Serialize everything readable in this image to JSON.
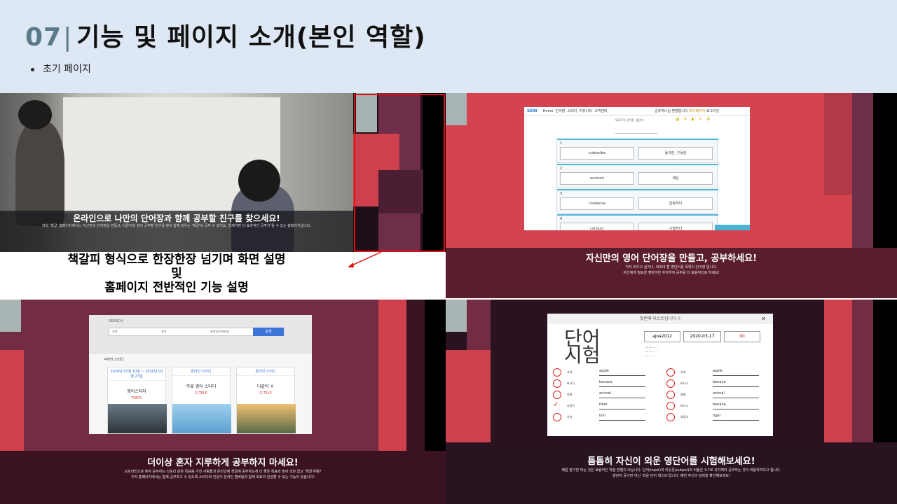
{
  "header": {
    "number": "07",
    "separator": "|",
    "title": "기능 및 페이지 소개(본인 역할)",
    "bullet": "초기 페이지"
  },
  "slide1": {
    "caption_title": "온라인으로 나만의 단어장과 함께 공부할 친구를 찾으세요!",
    "caption_sub": "저희 '책갈' 홈페이지에서는 자신만의 단어장을 만들고, 다른이와 같이 공부할 친구를 찾아 함께 외우는 '책갈'과 공부 수 있어요. 함께하면 더 효과적인 공부가 될 수 있는 홈페이지입니다.",
    "explain_line1": "책갈피 형식으로 한장한장 넘기며 화면 설명",
    "explain_line2": "및",
    "explain_line3": "홈페이지 전반적인 기능 설명"
  },
  "slide2": {
    "logo": "SEW",
    "nav": [
      "Home",
      "단어장",
      "스터디",
      "커뮤니티",
      "고객센터"
    ],
    "nav_right": [
      "공유하나님 환영합니다",
      "마이페이지",
      "로그아웃"
    ],
    "tabs": [
      "SQ 토익 단어장",
      "영단어"
    ],
    "rows": [
      {
        "no": "1",
        "word": "subscribe",
        "meaning": "동의한, 구독한"
      },
      {
        "no": "2",
        "word": "account",
        "meaning": "계산"
      },
      {
        "no": "3",
        "word": "condense",
        "meaning": "압축하다"
      },
      {
        "no": "4",
        "word": "conduct",
        "meaning": "시행하다"
      }
    ],
    "caption_title": "자신만의 영어 단어장을 만들고, 공부하세요!",
    "caption_sub1": "각자 외우고 싶거나, 외워야 할 영단어를 목록이 단어장 입니다.",
    "caption_sub2": "자신에게 필요한 영단어만 추가하여 공부를 더 효율적으로 하세요!"
  },
  "slide3": {
    "brand": "SEARCH",
    "search_fields": [
      "지역",
      "과목",
      "온라인/오프라인"
    ],
    "search_button": "검색",
    "count_label": "4개의 스터디",
    "cards": [
      {
        "top": "2020년 03월 10일 ~ 2020년 03월 27일",
        "name": "영어스터디",
        "sub": "TOEFL"
      },
      {
        "top": "온라인 스터디",
        "name": "무료 영어 스터디",
        "sub": "G-TELP"
      },
      {
        "top": "온라인 스터디",
        "name": "다같이 ㅎ",
        "sub": "G-TELP"
      }
    ],
    "caption_title": "더이상 혼자 지루하게 공부하지 마세요!",
    "caption_sub1": "오프라인으로 혼자 공부하는 것보다 같은 목표를 가진 사람들과 온라인에 책갈에 공부하는게 더 좋은 목표와 높아 것은 없고 '책갈'처럼?",
    "caption_sub2": "우리 홈페이지에서는 함께 공부하고 수 있도록 스터디와 인원이 온라인 캠버팅과 함께 목표의 단성할 수 있는 기능이 있습니다!"
  },
  "slide4": {
    "dialog_title": "첫번째 테스트입니다 !!",
    "big_text_line1": "단어",
    "big_text_line2": "시험",
    "user_id": "ajoa2012",
    "date": "2020-03-17",
    "score": "90",
    "left_rows": [
      {
        "k": "사과",
        "a": "apple"
      },
      {
        "k": "바나나",
        "a": "banana"
      },
      {
        "k": "동물",
        "a": "animal"
      },
      {
        "k": "호랑이",
        "a": "tiber"
      },
      {
        "k": "사자",
        "a": "lion"
      }
    ],
    "right_rows": [
      {
        "k": "사과",
        "a": "apple"
      },
      {
        "k": "바나나",
        "a": "banana"
      },
      {
        "k": "동물",
        "a": "animal"
      },
      {
        "k": "바나나",
        "a": "banana"
      },
      {
        "k": "호랑이",
        "a": "tiger"
      }
    ],
    "caption_title": "틈틈히 자신이 외운 영단어를 시험해보세요!",
    "caption_sub1": "매일 잘기만 하는 것은 효율적인 학습 방법이 아닙니다. 단어(input)과 아웃풋(output)의 비율은 3:7로 유지해야 공부하는 것이 바람직하다고 합니다.",
    "caption_sub2": "영단어 공기만 아닌 '외운 단어 테스트'입니다. 매번 자신의 실력을 확인해보세요!"
  }
}
